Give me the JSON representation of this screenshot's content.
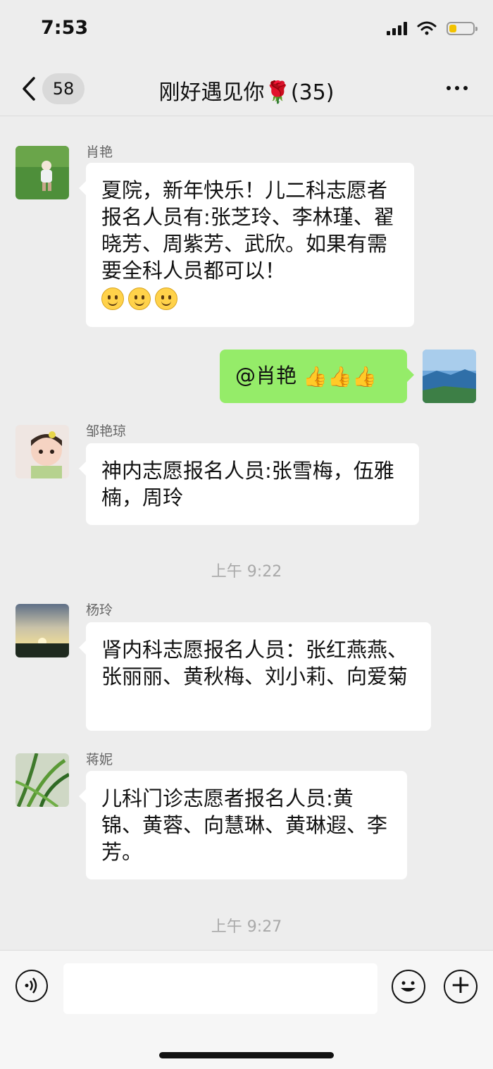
{
  "status_bar": {
    "time": "7:53",
    "battery_level": 0.3
  },
  "nav": {
    "unread_count": "58",
    "title": "刚好遇见你🌹(35)"
  },
  "messages": [
    {
      "sender": "肖艳",
      "text": "夏院，新年快乐！儿二科志愿者报名人员有:张芝玲、李林瑾、翟晓芳、周紫芳、武欣。如果有需要全科人员都可以！",
      "emoji_count": 3,
      "avatar_icon": "baby-in-grass-photo"
    },
    {
      "sender": "me",
      "text": "@肖艳",
      "emoji_count": 3,
      "emoji_name": "thumbs-up-icon",
      "avatar_icon": "landscape-photo"
    },
    {
      "sender": "邹艳琼",
      "text": "神内志愿报名人员:张雪梅，伍雅楠，周玲",
      "avatar_icon": "baby-face-photo"
    },
    {
      "timestamp": "上午 9:22"
    },
    {
      "sender": "杨玲",
      "text": "肾内科志愿报名人员：张红燕燕、张丽丽、黄秋梅、刘小莉、向爱菊",
      "avatar_icon": "sunset-photo"
    },
    {
      "sender": "蒋妮",
      "text": "儿科门诊志愿者报名人员:黄锦、黄蓉、向慧琳、黄琳遐、李芳。",
      "avatar_icon": "grass-photo"
    },
    {
      "timestamp": "上午 9:27"
    }
  ],
  "input_bar": {
    "value": "",
    "voice_icon": "voice-icon",
    "emoji_icon": "smile-icon",
    "plus_icon": "plus-icon"
  }
}
